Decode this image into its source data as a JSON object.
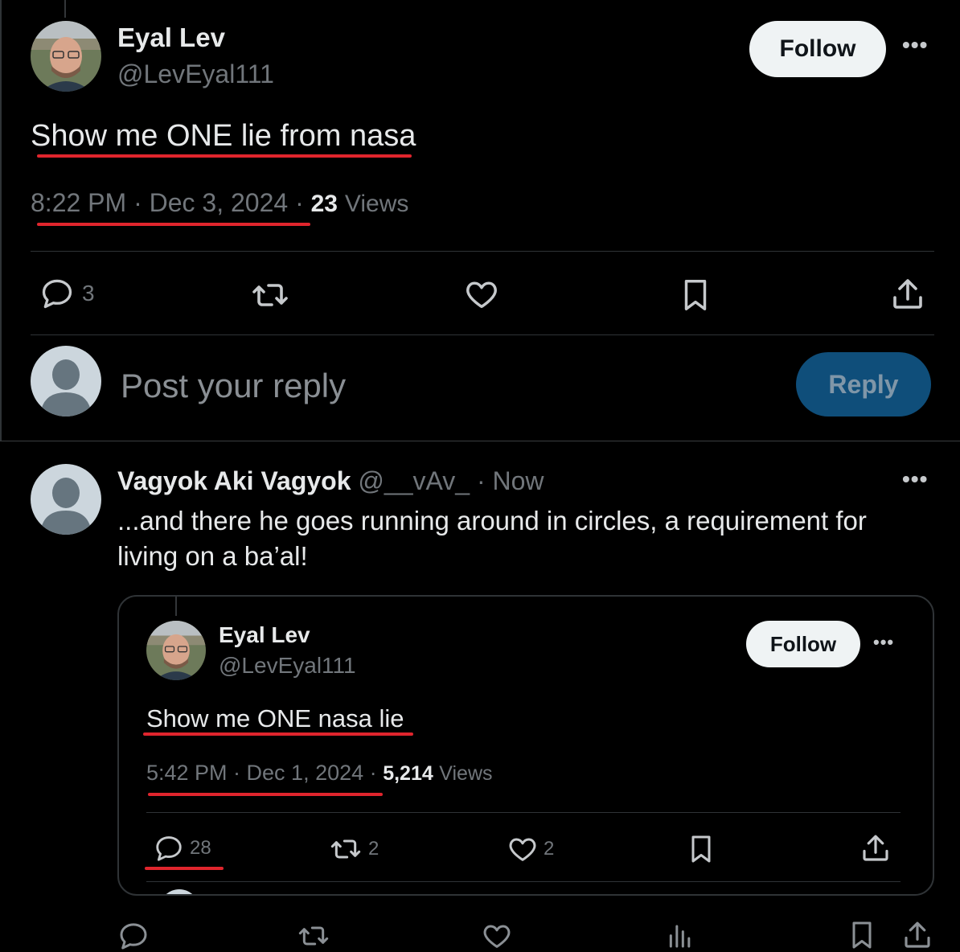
{
  "main_tweet": {
    "author_name": "Eyal Lev",
    "author_handle": "@LevEyal111",
    "follow_label": "Follow",
    "text": "Show me ONE lie from nasa",
    "time": "8:22 PM · Dec 3, 2024",
    "sep": "·",
    "views_count": "23",
    "views_label": "Views",
    "reply_count": "3"
  },
  "composer": {
    "placeholder": "Post your reply",
    "reply_label": "Reply"
  },
  "reply_tweet": {
    "author_name": "Vagyok Aki Vagyok",
    "author_handle": "@__vAv_",
    "time": "· Now",
    "text": "...and there he goes running around in circles, a requirement for living on a ba’al!"
  },
  "quoted_tweet": {
    "author_name": "Eyal Lev",
    "author_handle": "@LevEyal111",
    "follow_label": "Follow",
    "text": "Show me ONE nasa lie",
    "time": "5:42 PM · Dec 1, 2024",
    "sep": "·",
    "views_count": "5,214",
    "views_label": "Views",
    "reply_count": "28",
    "retweet_count": "2",
    "like_count": "2"
  },
  "colors": {
    "background": "#000000",
    "text": "#e7e9ea",
    "muted": "#71767b",
    "reply_button": "#0f4e7a",
    "annotation_red": "#e0252d"
  }
}
